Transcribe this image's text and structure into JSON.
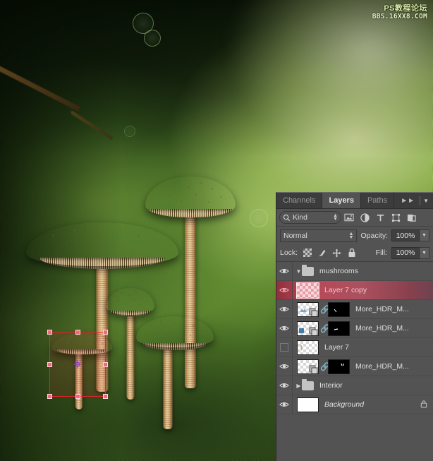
{
  "watermark": {
    "line1": "PS教程论坛",
    "line2": "BBS.16XX8.COM"
  },
  "panel": {
    "tabs": [
      {
        "label": "Channels",
        "active": false
      },
      {
        "label": "Layers",
        "active": true
      },
      {
        "label": "Paths",
        "active": false
      }
    ],
    "overflow_icon": "chevron-double-right-icon",
    "menu_icon": "panel-menu-icon",
    "filter": {
      "search_icon": "search-icon",
      "kind_label": "Kind",
      "icons": [
        "pixel-layer-filter-icon",
        "adjustment-layer-filter-icon",
        "type-layer-filter-icon",
        "shape-layer-filter-icon",
        "smart-object-filter-icon"
      ]
    },
    "blend": {
      "mode": "Normal",
      "opacity_label": "Opacity:",
      "opacity_value": "100%"
    },
    "lock": {
      "label": "Lock:",
      "icons": [
        "lock-transparent-pixels-icon",
        "lock-image-pixels-icon",
        "lock-position-icon",
        "lock-all-icon"
      ],
      "fill_label": "Fill:",
      "fill_value": "100%"
    },
    "layers": [
      {
        "name": "mushrooms",
        "type": "group",
        "visible": true,
        "expanded": true,
        "selected": false,
        "transparent_row": true,
        "locked": false
      },
      {
        "name": "Layer 7 copy",
        "type": "pixel",
        "visible": true,
        "selected": true,
        "transparent_row": false,
        "locked": false
      },
      {
        "name": "More_HDR_M...",
        "type": "smart-object-with-mask",
        "visible": true,
        "selected": false,
        "transparent_row": false,
        "locked": false
      },
      {
        "name": "More_HDR_M...",
        "type": "smart-object-with-mask",
        "visible": true,
        "selected": false,
        "transparent_row": false,
        "locked": false
      },
      {
        "name": "Layer 7",
        "type": "pixel",
        "visible": false,
        "selected": false,
        "transparent_row": false,
        "locked": false
      },
      {
        "name": "More_HDR_M...",
        "type": "smart-object-with-mask",
        "visible": true,
        "selected": false,
        "transparent_row": false,
        "locked": false
      },
      {
        "name": "Interior",
        "type": "group",
        "visible": true,
        "expanded": false,
        "selected": false,
        "transparent_row": false,
        "locked": false
      },
      {
        "name": "Background",
        "type": "background",
        "visible": true,
        "selected": false,
        "transparent_row": false,
        "locked": true
      }
    ]
  },
  "canvas": {
    "description": "Mossy forest floor photograph with five parasol mushrooms composited in",
    "transform_selection": {
      "tool": "free-transform",
      "border_color": "#e8202a",
      "handle_count": 8,
      "anchor_icon": "transform-reference-point-icon"
    },
    "colors": {
      "moss_bright": "#bede6e",
      "moss_dark": "#16280c",
      "mushroom_cap": "#e3c89c",
      "selection_red": "#e8202a",
      "panel_bg": "#535353",
      "selected_row": "#c44858"
    }
  }
}
